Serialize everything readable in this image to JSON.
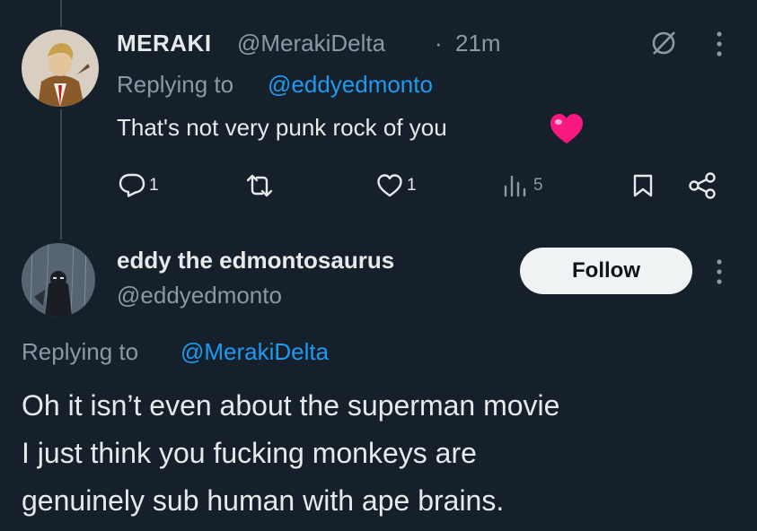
{
  "reply_tweet": {
    "display_name": "MERAKI",
    "handle": "@MerakiDelta",
    "separator": "·",
    "time": "21m",
    "replying_prefix": "Replying to",
    "replying_to": "@eddyedmonto",
    "text": "That's not very punk rock of you",
    "actions": {
      "reply_count": "1",
      "like_count": "1",
      "view_count": "5"
    }
  },
  "main_tweet": {
    "display_name": "eddy the edmontosaurus",
    "handle": "@eddyedmonto",
    "follow_label": "Follow",
    "replying_prefix": "Replying to",
    "replying_to": "@MerakiDelta",
    "text_lines": [
      "Oh it isn’t even about the superman movie",
      "I just think you fucking monkeys are",
      "genuinely sub human with ape brains."
    ]
  },
  "colors": {
    "background": "#15202b",
    "accent": "#1d9bf0",
    "muted": "#8b98a5",
    "heart": "#f91880"
  }
}
